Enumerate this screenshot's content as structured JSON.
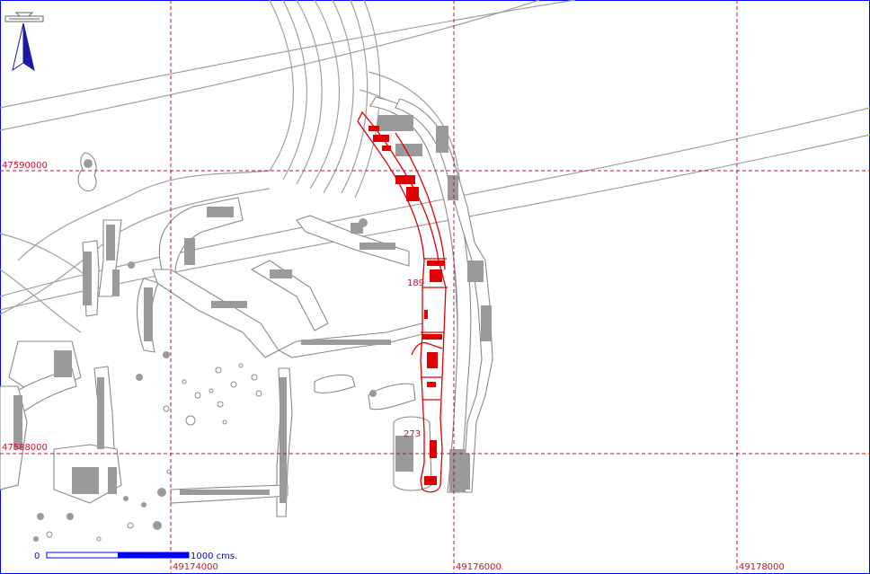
{
  "map": {
    "easting_labels": [
      "49174000",
      "49176000",
      "49178000"
    ],
    "northing_labels": [
      "47590000",
      "47588000"
    ],
    "scale_bar": {
      "start_label": "0",
      "end_label": "1000 cms."
    },
    "feature_labels": [
      "189",
      "273"
    ],
    "north_arrow": "north-arrow-icon",
    "colors": {
      "grid": "#c8102e",
      "highlight": "#e00000",
      "features": "#8a8a8a",
      "scale": "#0000ff",
      "frame": "#0000ff"
    }
  }
}
